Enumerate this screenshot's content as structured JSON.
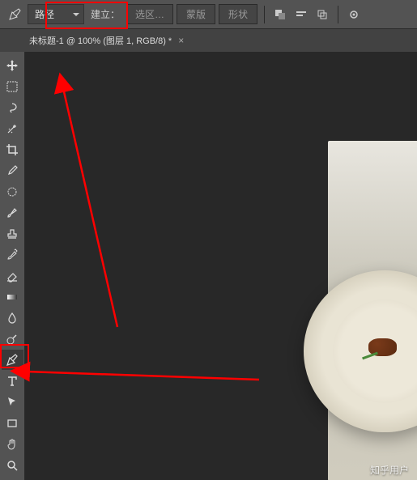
{
  "topbar": {
    "mode_dropdown": "路径",
    "create_label": "建立：",
    "btn_selection": "选区…",
    "btn_mask": "蒙版",
    "btn_shape": "形状"
  },
  "tab": {
    "title": "未标题-1 @ 100% (图层 1, RGB/8) *"
  },
  "tools": [
    {
      "name": "move-tool",
      "icon": "move"
    },
    {
      "name": "marquee-tool",
      "icon": "marquee"
    },
    {
      "name": "lasso-tool",
      "icon": "lasso"
    },
    {
      "name": "wand-tool",
      "icon": "wand"
    },
    {
      "name": "crop-tool",
      "icon": "crop"
    },
    {
      "name": "eyedropper-tool",
      "icon": "eyedropper"
    },
    {
      "name": "patch-tool",
      "icon": "patch"
    },
    {
      "name": "brush-tool",
      "icon": "brush"
    },
    {
      "name": "stamp-tool",
      "icon": "stamp"
    },
    {
      "name": "history-brush-tool",
      "icon": "history"
    },
    {
      "name": "eraser-tool",
      "icon": "eraser"
    },
    {
      "name": "gradient-tool",
      "icon": "gradient"
    },
    {
      "name": "blur-tool",
      "icon": "blur"
    },
    {
      "name": "dodge-tool",
      "icon": "dodge"
    },
    {
      "name": "pen-tool",
      "icon": "pen",
      "active": true
    },
    {
      "name": "type-tool",
      "icon": "type"
    },
    {
      "name": "path-select-tool",
      "icon": "pathselect"
    },
    {
      "name": "rectangle-tool",
      "icon": "rect"
    },
    {
      "name": "hand-tool",
      "icon": "hand"
    },
    {
      "name": "zoom-tool",
      "icon": "zoom"
    }
  ],
  "watermark": "知乎用户"
}
